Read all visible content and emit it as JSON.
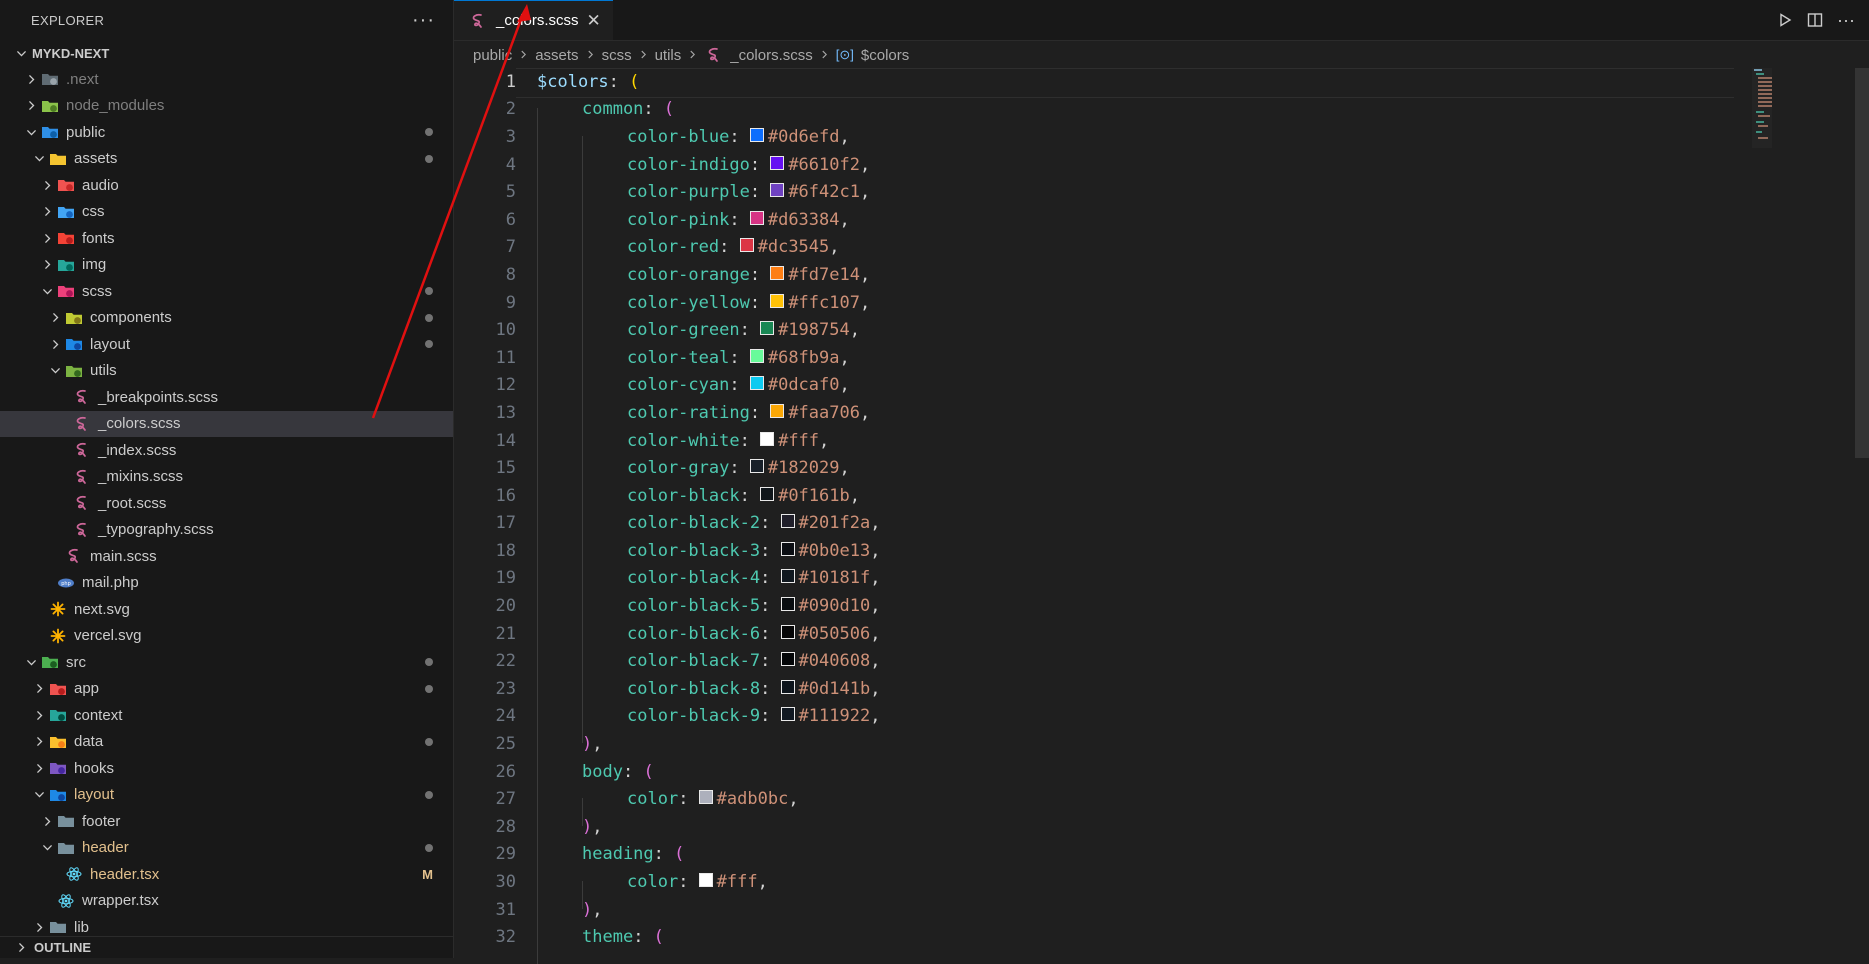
{
  "sidebar": {
    "title": "EXPLORER",
    "more": "···",
    "root": "MYKD-NEXT",
    "outline": "OUTLINE",
    "tree": [
      {
        "label": ".next",
        "depth": 1,
        "chev": "right",
        "icon": "folder-next",
        "dim": true
      },
      {
        "label": "node_modules",
        "depth": 1,
        "chev": "right",
        "icon": "folder-node",
        "dim": true
      },
      {
        "label": "public",
        "depth": 1,
        "chev": "down",
        "icon": "folder-public",
        "dot": true
      },
      {
        "label": "assets",
        "depth": 2,
        "chev": "down",
        "icon": "folder-yellow",
        "dot": true
      },
      {
        "label": "audio",
        "depth": 3,
        "chev": "right",
        "icon": "folder-red"
      },
      {
        "label": "css",
        "depth": 3,
        "chev": "right",
        "icon": "folder-blue"
      },
      {
        "label": "fonts",
        "depth": 3,
        "chev": "right",
        "icon": "folder-fonts"
      },
      {
        "label": "img",
        "depth": 3,
        "chev": "right",
        "icon": "folder-green"
      },
      {
        "label": "scss",
        "depth": 3,
        "chev": "down",
        "icon": "folder-pink",
        "dot": true
      },
      {
        "label": "components",
        "depth": 4,
        "chev": "right",
        "icon": "folder-components",
        "dot": true
      },
      {
        "label": "layout",
        "depth": 4,
        "chev": "right",
        "icon": "folder-layout",
        "dot": true
      },
      {
        "label": "utils",
        "depth": 4,
        "chev": "down",
        "icon": "folder-utils"
      },
      {
        "label": "_breakpoints.scss",
        "depth": 5,
        "icon": "sass"
      },
      {
        "label": "_colors.scss",
        "depth": 5,
        "icon": "sass",
        "selected": true
      },
      {
        "label": "_index.scss",
        "depth": 5,
        "icon": "sass"
      },
      {
        "label": "_mixins.scss",
        "depth": 5,
        "icon": "sass"
      },
      {
        "label": "_root.scss",
        "depth": 5,
        "icon": "sass"
      },
      {
        "label": "_typography.scss",
        "depth": 5,
        "icon": "sass"
      },
      {
        "label": "main.scss",
        "depth": 4,
        "icon": "sass"
      },
      {
        "label": "mail.php",
        "depth": 3,
        "icon": "php"
      },
      {
        "label": "next.svg",
        "depth": 2,
        "icon": "svg"
      },
      {
        "label": "vercel.svg",
        "depth": 2,
        "icon": "svg"
      },
      {
        "label": "src",
        "depth": 1,
        "chev": "down",
        "icon": "folder-src",
        "dot": true
      },
      {
        "label": "app",
        "depth": 2,
        "chev": "right",
        "icon": "folder-app",
        "dot": true
      },
      {
        "label": "context",
        "depth": 2,
        "chev": "right",
        "icon": "folder-context"
      },
      {
        "label": "data",
        "depth": 2,
        "chev": "right",
        "icon": "folder-data",
        "dot": true
      },
      {
        "label": "hooks",
        "depth": 2,
        "chev": "right",
        "icon": "folder-hooks"
      },
      {
        "label": "layout",
        "depth": 2,
        "chev": "down",
        "icon": "folder-layout",
        "mod": true,
        "dot": true
      },
      {
        "label": "footer",
        "depth": 3,
        "chev": "right",
        "icon": "folder-grey"
      },
      {
        "label": "header",
        "depth": 3,
        "chev": "down",
        "icon": "folder-grey",
        "mod": true,
        "dot": true
      },
      {
        "label": "header.tsx",
        "depth": 4,
        "icon": "react",
        "mod": true,
        "badge": "M"
      },
      {
        "label": "wrapper.tsx",
        "depth": 3,
        "icon": "react"
      },
      {
        "label": "lib",
        "depth": 2,
        "chev": "right",
        "icon": "folder-grey"
      }
    ]
  },
  "tab": {
    "label": "_colors.scss",
    "close": "✕"
  },
  "breadcrumb": [
    "public",
    "assets",
    "scss",
    "utils",
    "_colors.scss",
    "$colors"
  ],
  "code": {
    "current_line": 1,
    "var_name": "$colors",
    "groups": [
      {
        "key": "common",
        "start": 2,
        "entries": [
          {
            "name": "color-blue",
            "value": "#0d6efd"
          },
          {
            "name": "color-indigo",
            "value": "#6610f2"
          },
          {
            "name": "color-purple",
            "value": "#6f42c1"
          },
          {
            "name": "color-pink",
            "value": "#d63384"
          },
          {
            "name": "color-red",
            "value": "#dc3545"
          },
          {
            "name": "color-orange",
            "value": "#fd7e14"
          },
          {
            "name": "color-yellow",
            "value": "#ffc107"
          },
          {
            "name": "color-green",
            "value": "#198754"
          },
          {
            "name": "color-teal",
            "value": "#68fb9a"
          },
          {
            "name": "color-cyan",
            "value": "#0dcaf0"
          },
          {
            "name": "color-rating",
            "value": "#faa706"
          },
          {
            "name": "color-white",
            "value": "#fff"
          },
          {
            "name": "color-gray",
            "value": "#182029"
          },
          {
            "name": "color-black",
            "value": "#0f161b"
          },
          {
            "name": "color-black-2",
            "value": "#201f2a"
          },
          {
            "name": "color-black-3",
            "value": "#0b0e13"
          },
          {
            "name": "color-black-4",
            "value": "#10181f"
          },
          {
            "name": "color-black-5",
            "value": "#090d10"
          },
          {
            "name": "color-black-6",
            "value": "#050506"
          },
          {
            "name": "color-black-7",
            "value": "#040608"
          },
          {
            "name": "color-black-8",
            "value": "#0d141b"
          },
          {
            "name": "color-black-9",
            "value": "#111922"
          }
        ]
      },
      {
        "key": "body",
        "entries": [
          {
            "name": "color",
            "value": "#adb0bc"
          }
        ]
      },
      {
        "key": "heading",
        "entries": [
          {
            "name": "color",
            "value": "#fff"
          }
        ]
      }
    ],
    "trailing_key": "theme"
  },
  "colors": {
    "accent": "#0078d4",
    "sass": "#cd6799",
    "react": "#61dafb",
    "arrow": "#e01010"
  }
}
